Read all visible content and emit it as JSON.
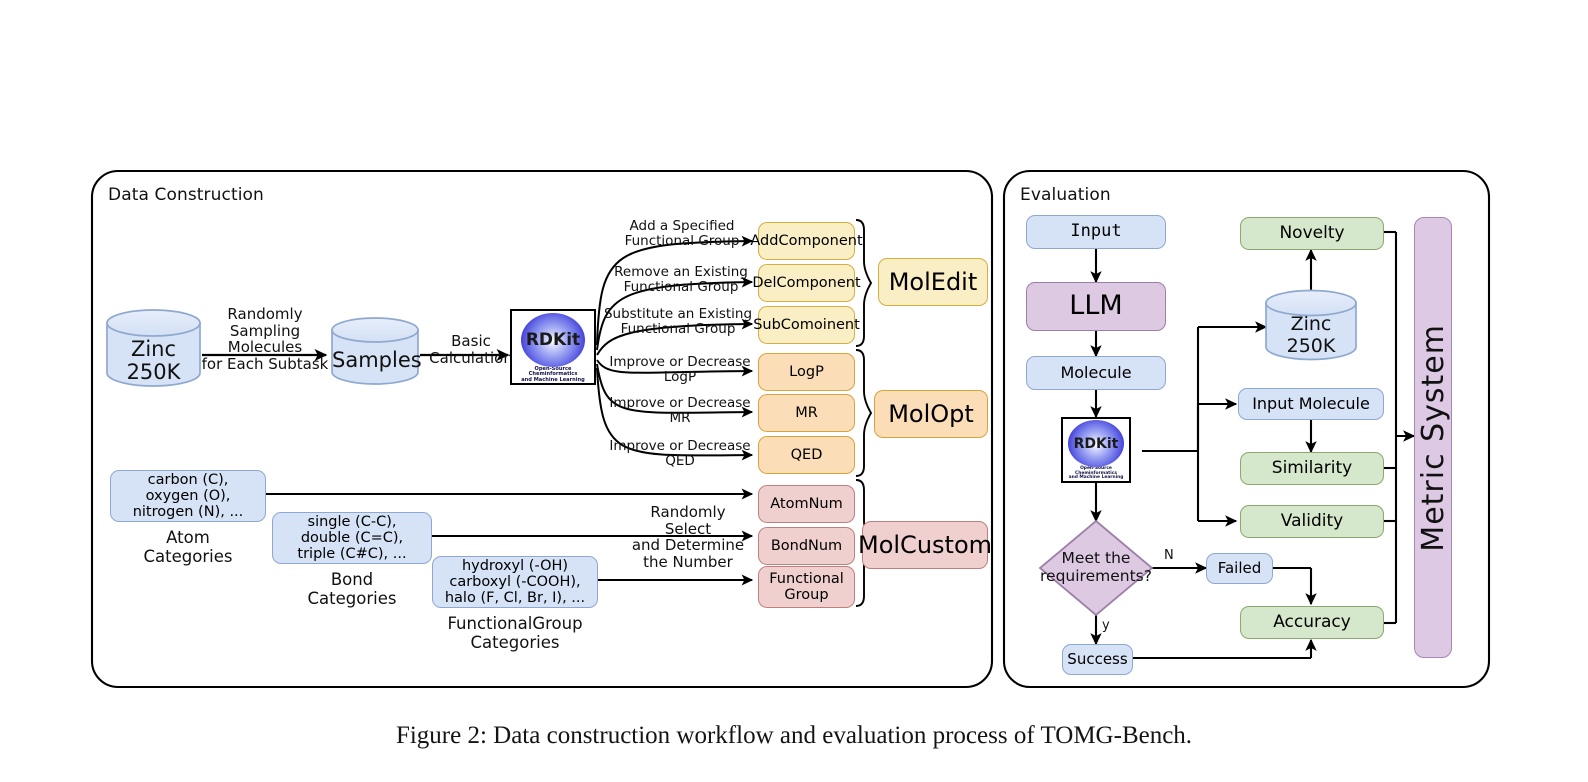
{
  "figure": {
    "caption": "Figure 2: Data construction workflow and evaluation process of TOMG-Bench."
  },
  "panels": {
    "left": {
      "title": "Data Construction"
    },
    "right": {
      "title": "Evaluation"
    }
  },
  "data_construction": {
    "source_db": {
      "line1": "Zinc",
      "line2": "250K"
    },
    "samples_db": {
      "line1": "Samples"
    },
    "rdkit": {
      "name": "RDKit",
      "subtitle_line1": "Open-Source Cheminformatics",
      "subtitle_line2": "and Machine Learning"
    },
    "edge_sampling": "Randomly\nSampling\nMolecules\nfor Each Subtask",
    "edge_sampling_lines": [
      "Randomly",
      "Sampling",
      "Molecules",
      "for Each Subtask"
    ],
    "edge_basic_lines": [
      "Basic",
      "Calculation"
    ],
    "edge_random_select_lines": [
      "Randomly",
      "Select",
      "and Determine",
      "the Number"
    ],
    "branches": [
      {
        "label_lines": [
          "Add a Specified",
          "Functional Group"
        ],
        "task": "AddComponent",
        "group": "MolEdit"
      },
      {
        "label_lines": [
          "Remove an Existing",
          "Functional Group"
        ],
        "task": "DelComponent",
        "group": "MolEdit"
      },
      {
        "label_lines": [
          "Substitute an Existing",
          "Functional Group"
        ],
        "task": "SubComoinent",
        "group": "MolEdit"
      },
      {
        "label_lines": [
          "Improve or Decrease",
          "LogP"
        ],
        "task": "LogP",
        "group": "MolOpt"
      },
      {
        "label_lines": [
          "Improve or Decrease",
          "MR"
        ],
        "task": "MR",
        "group": "MolOpt"
      },
      {
        "label_lines": [
          "Improve or Decrease",
          "QED"
        ],
        "task": "QED",
        "group": "MolOpt"
      }
    ],
    "custom_tasks": [
      {
        "task_lines": [
          "AtomNum"
        ]
      },
      {
        "task_lines": [
          "BondNum"
        ]
      },
      {
        "task_lines": [
          "Functional",
          "Group"
        ]
      }
    ],
    "groups": {
      "moledit": "MolEdit",
      "molopt": "MolOpt",
      "molcustom": "MolCustom"
    },
    "categories": [
      {
        "box_lines": [
          "carbon (C),",
          "oxygen (O),",
          "nitrogen (N), ..."
        ],
        "caption_lines": [
          "Atom",
          "Categories"
        ]
      },
      {
        "box_lines": [
          "single (C-C),",
          "double (C=C),",
          "triple (C#C), ..."
        ],
        "caption_lines": [
          "Bond",
          "Categories"
        ]
      },
      {
        "box_lines": [
          "hydroxyl (-OH)",
          "carboxyl (-COOH),",
          "halo (F, Cl, Br, I), ..."
        ],
        "caption_lines": [
          "FunctionalGroup",
          "Categories"
        ]
      }
    ]
  },
  "evaluation": {
    "input": "Input",
    "llm": "LLM",
    "molecule": "Molecule",
    "rdkit": {
      "name": "RDKit",
      "subtitle_line1": "Open-Source Cheminformatics",
      "subtitle_line2": "and Machine Learning"
    },
    "decision_lines": [
      "Meet the",
      "requirements?"
    ],
    "decision_no": "N",
    "decision_yes": "y",
    "failed": "Failed",
    "success": "Success",
    "novelty": "Novelty",
    "zinc": {
      "line1": "Zinc",
      "line2": "250K"
    },
    "input_molecule": "Input Molecule",
    "similarity": "Similarity",
    "validity": "Validity",
    "accuracy": "Accuracy",
    "metric_system": "Metric System"
  },
  "colors": {
    "blue_fill": "#d6e2f5",
    "blue_stroke": "#8fa8d0",
    "purple_fill": "#ddc9e2",
    "green_fill": "#d6e8cc",
    "green_stroke": "#89a96f",
    "cream_fill": "#faeec4",
    "cream_stroke": "#d4ae3e",
    "peach_fill": "#fbddb7",
    "rose_fill": "#f0cfcf",
    "lilac_fill": "#ddc9e4",
    "line": "#000000"
  },
  "icons": {
    "rdkit_logo": "rdkit-logo-icon",
    "database_cylinder": "database-cylinder-icon",
    "arrow": "arrow-icon",
    "decision_diamond": "decision-diamond-icon",
    "curly_brace": "curly-brace-icon"
  }
}
